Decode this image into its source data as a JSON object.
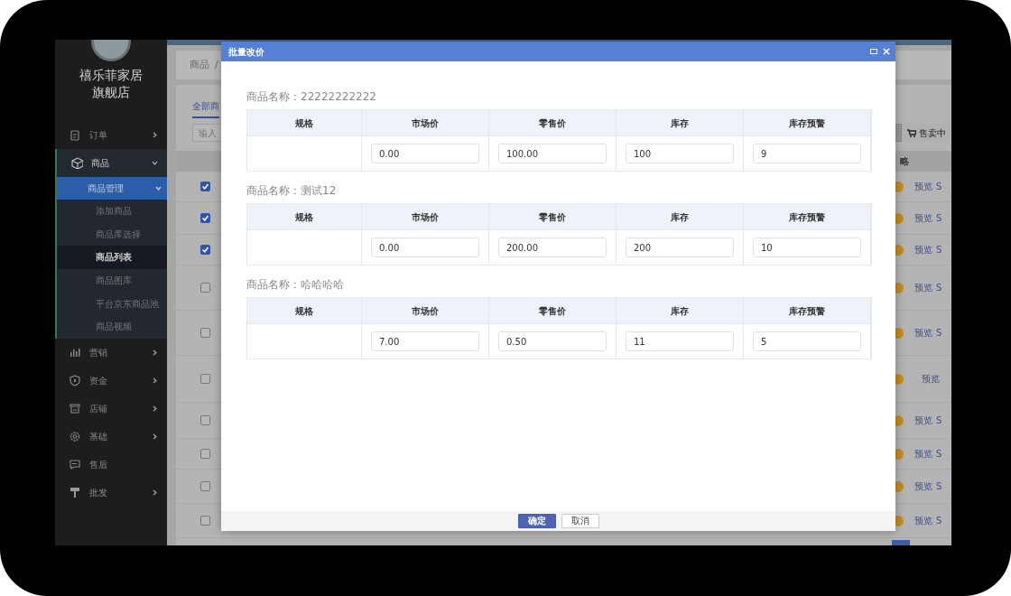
{
  "sidebar": {
    "store_name": "禧乐菲家居旗舰店",
    "menu": [
      {
        "label": "订单",
        "kind": "folder",
        "expanded": false
      },
      {
        "label": "商品",
        "kind": "folder",
        "expanded": true,
        "children": [
          {
            "label": "商品管理",
            "expanded": true,
            "children": [
              {
                "label": "添加商品",
                "selected": false
              },
              {
                "label": "商品库选择",
                "selected": false
              },
              {
                "label": "商品列表",
                "selected": true
              },
              {
                "label": "商品图库",
                "selected": false
              },
              {
                "label": "平台京东商品池",
                "selected": false
              },
              {
                "label": "商品视频",
                "selected": false
              }
            ]
          }
        ]
      },
      {
        "label": "营销",
        "kind": "folder",
        "expanded": false
      },
      {
        "label": "资金",
        "kind": "folder",
        "expanded": false
      },
      {
        "label": "店铺",
        "kind": "folder",
        "expanded": false
      },
      {
        "label": "基础",
        "kind": "folder",
        "expanded": false
      },
      {
        "label": "售后",
        "kind": "link"
      },
      {
        "label": "批发",
        "kind": "folder",
        "expanded": false
      }
    ]
  },
  "breadcrumb": {
    "item": "商品",
    "separator": "/"
  },
  "tab": "全部商",
  "search": {
    "placeholder": "输入"
  },
  "status_button": "售卖中",
  "table": {
    "column_last": "略",
    "rows": [
      {
        "checked": true,
        "links": [
          "预览",
          "S"
        ]
      },
      {
        "checked": true,
        "links": [
          "预览",
          "S"
        ]
      },
      {
        "checked": true,
        "links": [
          "预览",
          "S"
        ]
      },
      {
        "checked": false,
        "links": [
          "预览",
          "S"
        ]
      },
      {
        "checked": false,
        "links": [
          "预览",
          "S"
        ]
      },
      {
        "checked": false,
        "links": [
          "预览"
        ]
      },
      {
        "checked": false,
        "links": [
          "预览",
          "S"
        ]
      },
      {
        "checked": false,
        "links": [
          "预览",
          "S"
        ]
      },
      {
        "checked": false,
        "links": [
          "预览",
          "S"
        ]
      },
      {
        "checked": false,
        "links": [
          "预览",
          "S"
        ]
      }
    ]
  },
  "modal": {
    "title": "批量改价",
    "products": [
      {
        "name": "商品名称：22222222222",
        "columns": [
          "规格",
          "市场价",
          "零售价",
          "库存",
          "库存预警"
        ],
        "values": [
          "0.00",
          "100.00",
          "100",
          "9"
        ]
      },
      {
        "name": "商品名称：测试12",
        "columns": [
          "规格",
          "市场价",
          "零售价",
          "库存",
          "库存预警"
        ],
        "values": [
          "0.00",
          "200.00",
          "200",
          "10"
        ]
      },
      {
        "name": "商品名称：哈哈哈哈",
        "columns": [
          "规格",
          "市场价",
          "零售价",
          "库存",
          "库存预警"
        ],
        "values": [
          "7.00",
          "0.50",
          "11",
          "5"
        ]
      }
    ],
    "buttons": [
      {
        "label": "确定",
        "kind": "primary"
      },
      {
        "label": "取消",
        "kind": "default"
      }
    ]
  }
}
